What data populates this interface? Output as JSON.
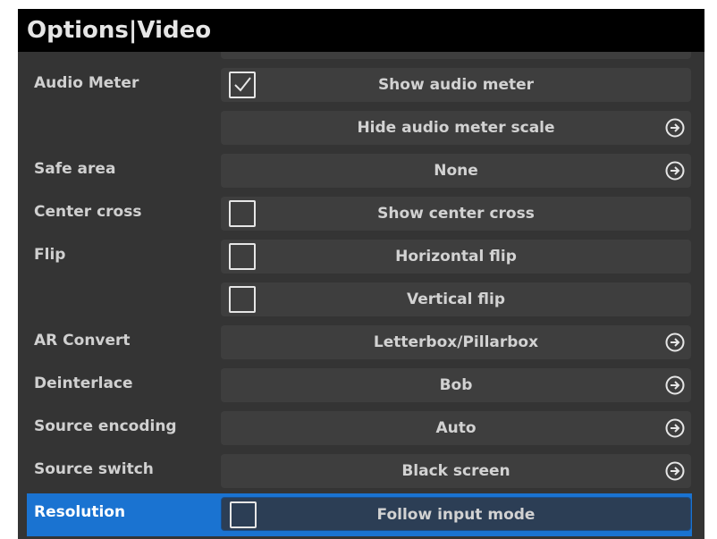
{
  "window": {
    "title": "Options|Video"
  },
  "rows": [
    {
      "label": "Audio Meter",
      "text": "Show audio meter",
      "checkbox": true,
      "checked": true,
      "arrow": false
    },
    {
      "label": "",
      "text": "Hide audio meter scale",
      "checkbox": false,
      "arrow": true
    },
    {
      "label": "Safe area",
      "text": "None",
      "checkbox": false,
      "arrow": true
    },
    {
      "label": "Center cross",
      "text": "Show center cross",
      "checkbox": true,
      "checked": false,
      "arrow": false
    },
    {
      "label": "Flip",
      "text": "Horizontal flip",
      "checkbox": true,
      "checked": false,
      "arrow": false
    },
    {
      "label": "",
      "text": "Vertical flip",
      "checkbox": true,
      "checked": false,
      "arrow": false
    },
    {
      "label": "AR Convert",
      "text": "Letterbox/Pillarbox",
      "checkbox": false,
      "arrow": true
    },
    {
      "label": "Deinterlace",
      "text": "Bob",
      "checkbox": false,
      "arrow": true
    },
    {
      "label": "Source encoding",
      "text": "Auto",
      "checkbox": false,
      "arrow": true
    },
    {
      "label": "Source switch",
      "text": "Black screen",
      "checkbox": false,
      "arrow": true
    },
    {
      "label": "Resolution",
      "text": "Follow input mode",
      "checkbox": true,
      "checked": false,
      "arrow": false,
      "selected": true
    }
  ],
  "colors": {
    "selection": "#1a73d1",
    "titlebar": "#000000",
    "background": "#343434"
  },
  "icons": {
    "checkbox": "checkbox-icon",
    "arrow": "circle-arrow-right-icon"
  }
}
